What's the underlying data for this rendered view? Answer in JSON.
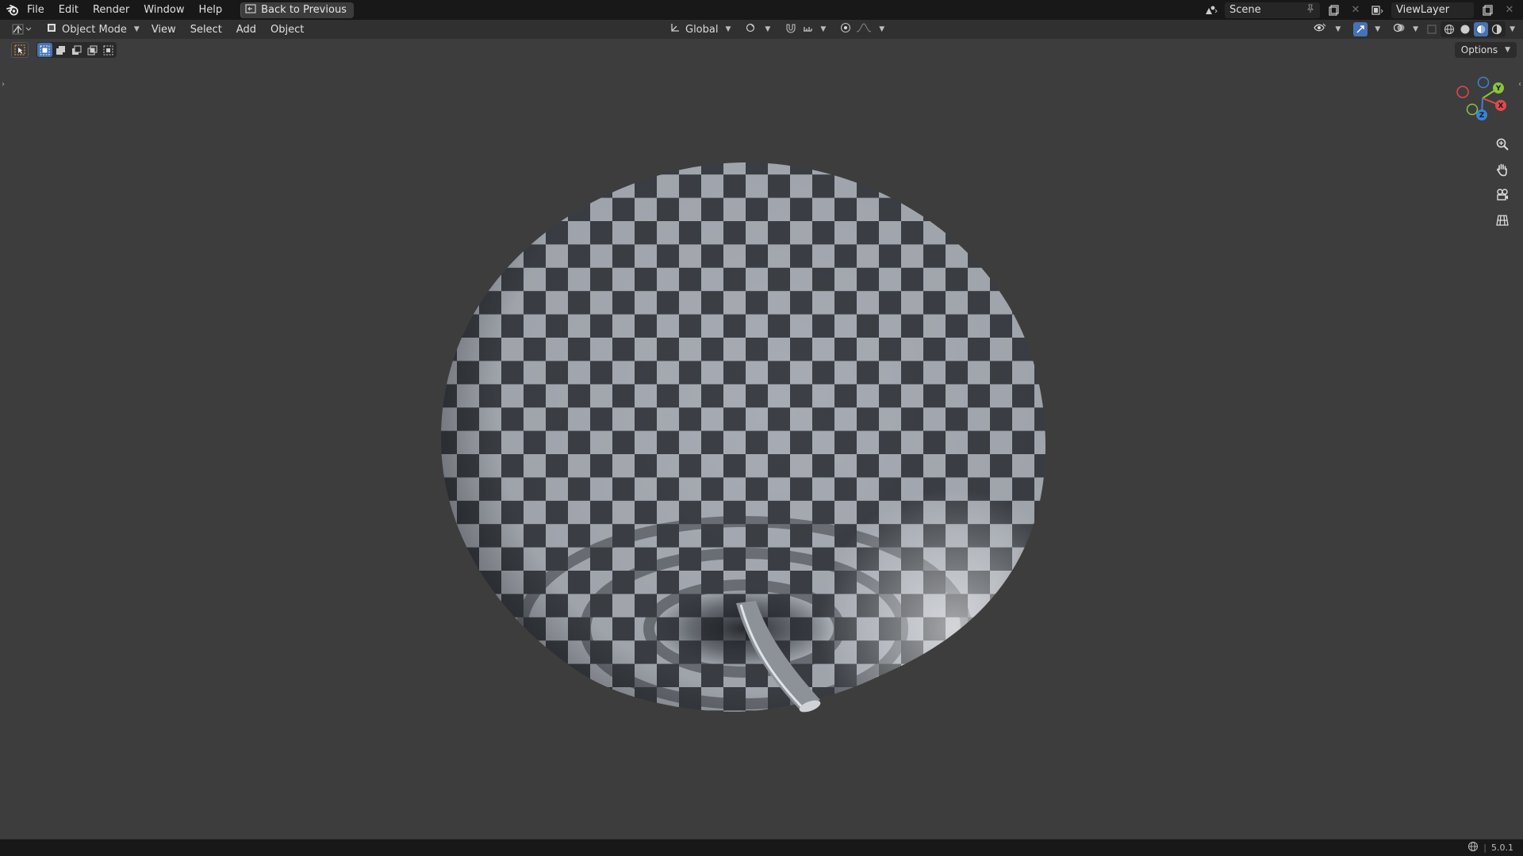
{
  "topbar": {
    "menus": [
      "File",
      "Edit",
      "Render",
      "Window",
      "Help"
    ],
    "back_button": "Back to Previous",
    "scene": "Scene",
    "view_layer": "ViewLayer"
  },
  "header": {
    "mode": "Object Mode",
    "menus": [
      "View",
      "Select",
      "Add",
      "Object"
    ],
    "transform_orientation": "Global"
  },
  "viewport": {
    "options_label": "Options",
    "gizmo_axes": [
      "X",
      "Y",
      "Z"
    ]
  },
  "statusbar": {
    "version": "5.0.1"
  },
  "colors": {
    "accent": "#4772b3",
    "axis_x": "#e04a4a",
    "axis_y": "#8ac43f",
    "axis_z": "#3b82d6"
  }
}
